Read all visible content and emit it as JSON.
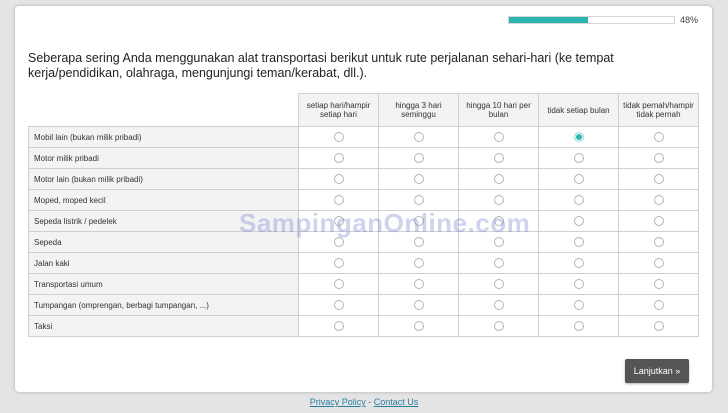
{
  "progress": {
    "percent_value": 0.48,
    "label": "48%"
  },
  "question": "Seberapa sering Anda menggunakan alat transportasi berikut untuk rute perjalanan sehari-hari (ke tempat kerja/pendidikan, olahraga, mengunjungi teman/kerabat, dll.).",
  "columns": [
    "setiap hari/hampir setiap hari",
    "hingga 3 hari seminggu",
    "hingga 10 hari per bulan",
    "tidak setiap bulan",
    "tidak pernah/hampir tidak pernah"
  ],
  "rows": [
    {
      "label": "Mobil lain (bukan milik pribadi)",
      "selected": 3
    },
    {
      "label": "Motor milik pribadi",
      "selected": -1
    },
    {
      "label": "Motor lain (bukan milik pribadi)",
      "selected": -1
    },
    {
      "label": "Moped, moped kecil",
      "selected": -1
    },
    {
      "label": "Sepeda listrik / pedelek",
      "selected": -1
    },
    {
      "label": "Sepeda",
      "selected": -1
    },
    {
      "label": "Jalan kaki",
      "selected": -1
    },
    {
      "label": "Transportasi umum",
      "selected": -1
    },
    {
      "label": "Tumpangan (omprengan, berbagi tumpangan, ...)",
      "selected": -1
    },
    {
      "label": "Taksi",
      "selected": -1
    }
  ],
  "watermark": "SampinganOnline.com",
  "next_button": "Lanjutkan »",
  "footer": {
    "privacy": "Privacy Policy",
    "separator": " - ",
    "contact": "Contact Us"
  },
  "colors": {
    "accent": "#2ab7b0",
    "button": "#555555"
  }
}
